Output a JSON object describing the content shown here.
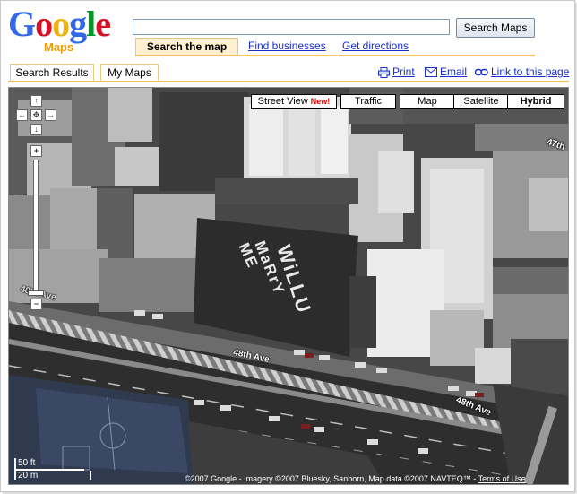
{
  "brand": {
    "logo_letters": [
      "G",
      "o",
      "o",
      "g",
      "l",
      "e"
    ],
    "logo_colors": [
      "#3369e8",
      "#d50f25",
      "#eeb211",
      "#3369e8",
      "#009925",
      "#d50f25"
    ],
    "product": "Maps"
  },
  "search": {
    "query": "",
    "button_label": "Search Maps",
    "tabs": {
      "active": "Search the map",
      "businesses": "Find businesses",
      "directions": "Get directions"
    }
  },
  "panel": {
    "tabs": [
      "Search Results",
      "My Maps"
    ],
    "links": {
      "print": "Print",
      "email": "Email",
      "link": "Link to this page"
    }
  },
  "map": {
    "street_view": "Street View",
    "new_badge": "New!",
    "traffic": "Traffic",
    "map_type": "Map",
    "satellite": "Satellite",
    "hybrid": "Hybrid",
    "selected_type": "Hybrid",
    "roads": {
      "main_1": "48th Ave",
      "main_2": "48th Ave",
      "corner": "47th",
      "side": "48th Ave"
    },
    "rooftop_message": [
      "WiLLU",
      "MaRrY",
      "ME"
    ],
    "scale": {
      "feet": "50 ft",
      "meters": "20 m"
    },
    "copyright": "©2007 Google - Imagery ©2007 Bluesky, Sanborn, Map data ©2007 NAVTEQ™ - ",
    "terms": "Terms of Use"
  },
  "colors": {
    "accent_tab": "#f2c35f",
    "link": "#1a2fcc",
    "logo_sub": "#f29a00"
  }
}
